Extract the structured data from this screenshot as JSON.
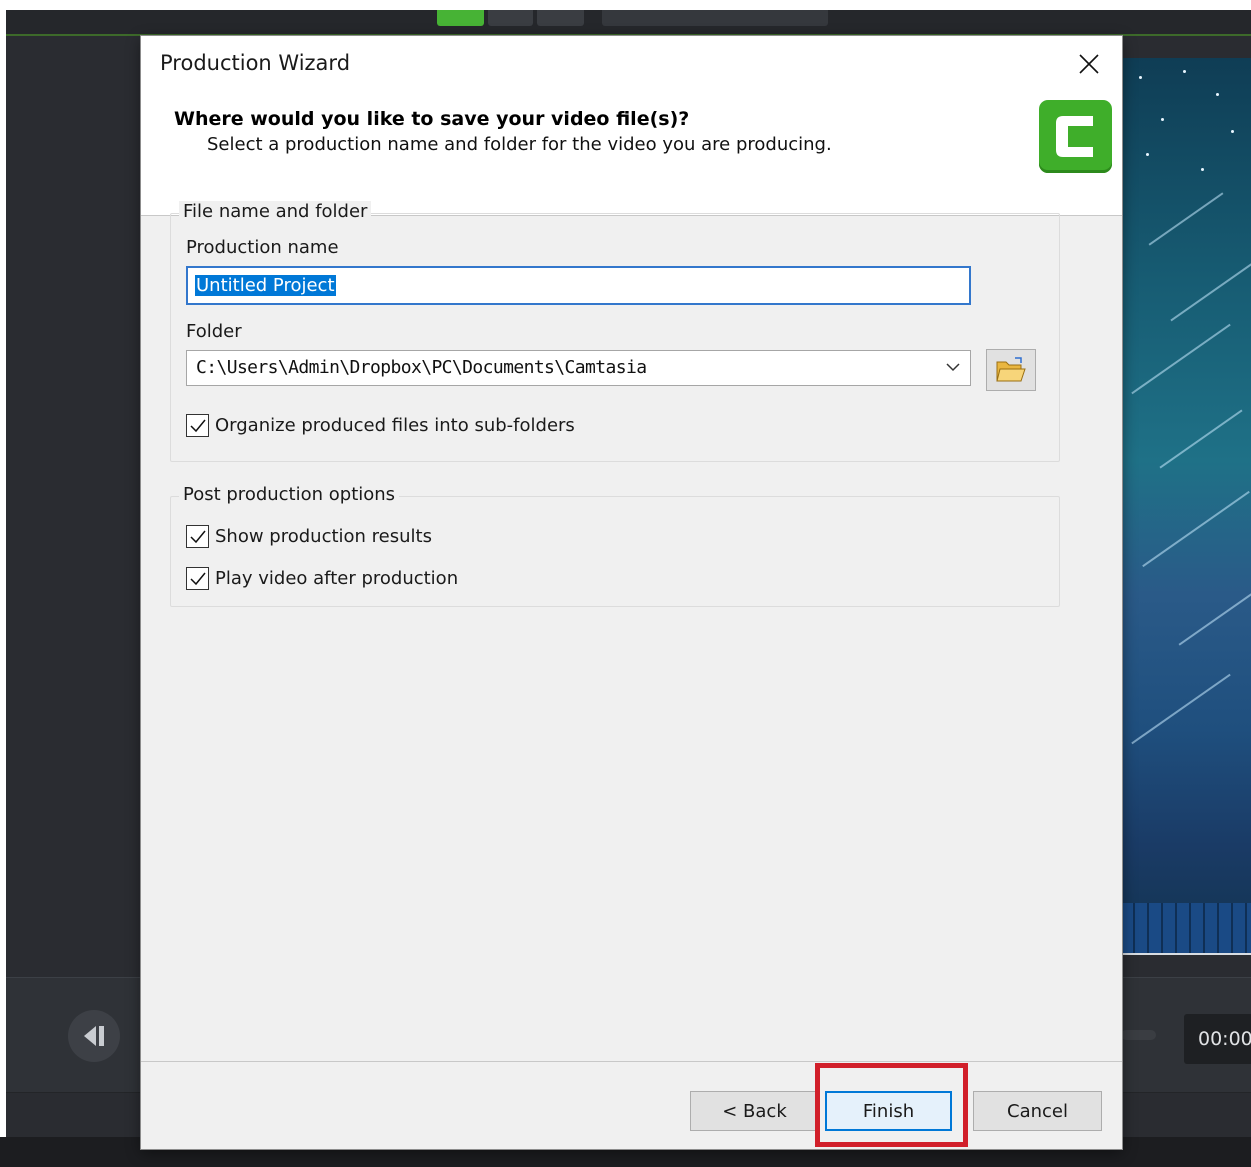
{
  "dialog": {
    "title": "Production Wizard",
    "header_title": "Where would you like to save your video file(s)?",
    "header_subtitle": "Select a production name and folder for the video you are producing.",
    "logo_icon": "camtasia-logo-icon",
    "brand_color": "#3fae2a"
  },
  "file_group": {
    "legend": "File name and folder",
    "production_name_label": "Production name",
    "production_name_value": "Untitled Project",
    "folder_label": "Folder",
    "folder_value": "C:\\Users\\Admin\\Dropbox\\PC\\Documents\\Camtasia",
    "organize_label": "Organize produced files into sub-folders",
    "organize_checked": true
  },
  "post_group": {
    "legend": "Post production options",
    "show_results_label": "Show production results",
    "show_results_checked": true,
    "play_video_label": "Play video after production",
    "play_video_checked": true
  },
  "buttons": {
    "back": "< Back",
    "finish": "Finish",
    "cancel": "Cancel"
  },
  "background_app": {
    "time_readout": "00:00",
    "accent_color": "#47b335"
  },
  "annotation": {
    "highlight_color": "#d11f2a",
    "highlight_target": "finish-button"
  }
}
